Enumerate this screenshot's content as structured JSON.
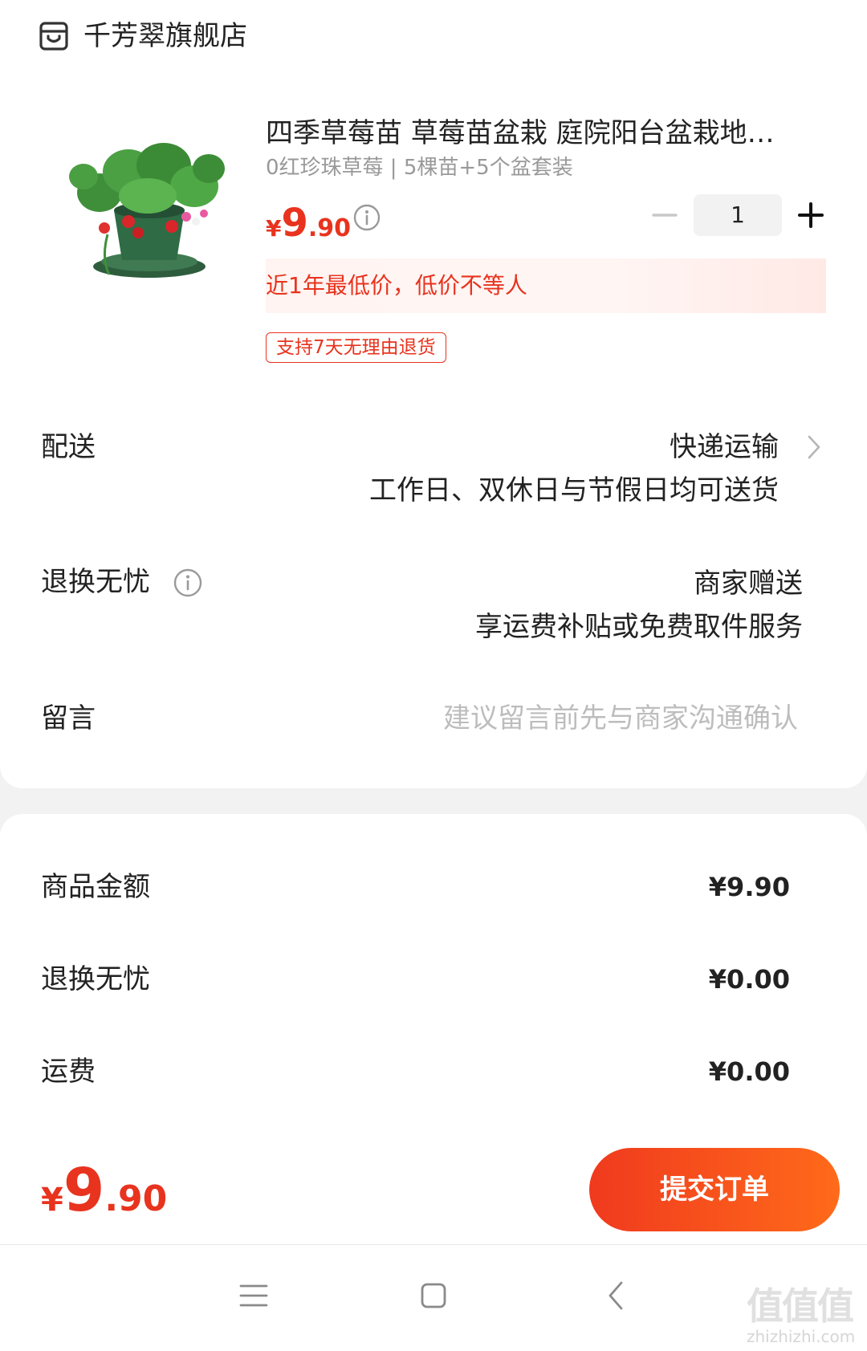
{
  "store": {
    "name": "千芳翠旗舰店",
    "icon": "store-icon"
  },
  "product": {
    "title": "四季草莓苗 草莓苗盆栽 庭院阳台盆栽地…",
    "sku": "0红珍珠草莓 | 5棵苗+5个盆套装",
    "price": {
      "currency": "¥",
      "integer": "9",
      "decimal": ".90"
    },
    "quantity": "1",
    "lowest_price_note": "近1年最低价，低价不等人",
    "return_tag": "支持7天无理由退货",
    "image": "strawberry-plant-pot"
  },
  "delivery": {
    "label": "配送",
    "method": "快递运输",
    "desc": "工作日、双休日与节假日均可送货"
  },
  "return_service": {
    "label": "退换无忧",
    "value": "商家赠送",
    "desc": "享运费补贴或免费取件服务"
  },
  "message": {
    "label": "留言",
    "placeholder": "建议留言前先与商家沟通确认"
  },
  "summary": [
    {
      "label": "商品金额",
      "value": "¥9.90"
    },
    {
      "label": "退换无忧",
      "value": "¥0.00"
    },
    {
      "label": "运费",
      "value": "¥0.00"
    }
  ],
  "total": {
    "currency": "¥",
    "integer": "9",
    "decimal": ".90"
  },
  "submit_label": "提交订单",
  "watermark": {
    "text": "值值值",
    "url": "zhizhizhi.com"
  },
  "colors": {
    "accent": "#e8331e",
    "button_start": "#f03a1e",
    "button_end": "#ff6a1a"
  }
}
